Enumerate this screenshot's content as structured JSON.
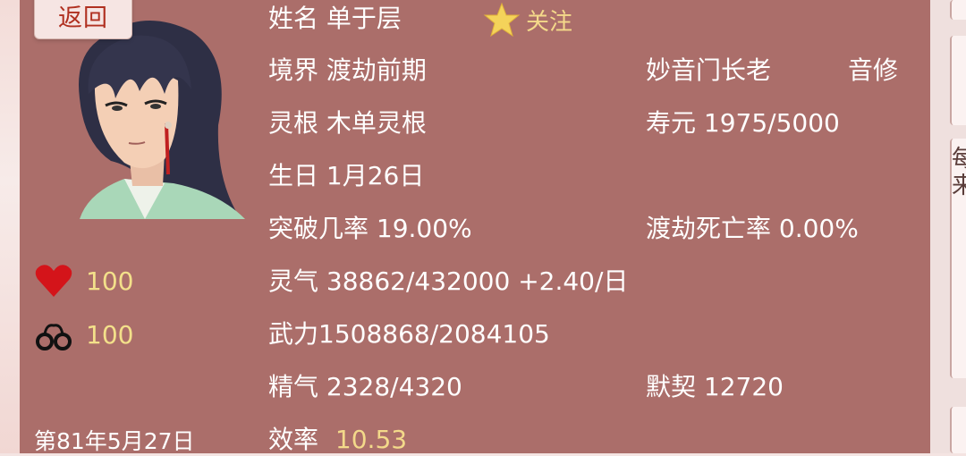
{
  "back_label": "返回",
  "follow_label": "关注",
  "name": "姓名 单于层",
  "realm": "境界 渡劫前期",
  "sect": "妙音门长老",
  "class": "音修",
  "root": "灵根 木单灵根",
  "lifespan": "寿元 1975/5000",
  "birthday": "生日 1月26日",
  "breakthrough": "突破几率 19.00%",
  "tribulation": "渡劫死亡率 0.00%",
  "qi": "灵气 38862/432000 +2.40/日",
  "power": "武力1508868/2084105",
  "essence": "精气 2328/4320",
  "rapport": "默契 12720",
  "efficiency_label": "效率",
  "efficiency_value": "10.53",
  "health": "100",
  "chains": "100",
  "date": "第81年5月27日",
  "side_tabs": [
    "",
    "每",
    "来"
  ],
  "colors": {
    "panel": "#ab6e6a",
    "highlight": "#f3d98a",
    "heart": "#d4141a"
  }
}
